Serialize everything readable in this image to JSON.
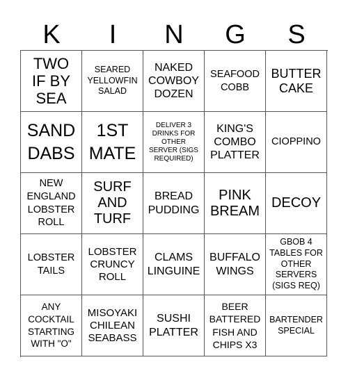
{
  "title_letters": [
    "K",
    "I",
    "N",
    "G",
    "S"
  ],
  "cells": [
    [
      "TWO IF BY SEA",
      "SEARED YELLOWFIN SALAD",
      "NAKED COWBOY DOZEN",
      "SEAFOOD COBB",
      "BUTTER CAKE"
    ],
    [
      "SAND DABS",
      "1ST MATE",
      "DELIVER 3 DRINKS FOR OTHER SERVER (SIGS REQUIRED)",
      "KING'S COMBO PLATTER",
      "CIOPPINO"
    ],
    [
      "NEW ENGLAND LOBSTER ROLL",
      "SURF AND TURF",
      "BREAD PUDDING",
      "PINK BREAM",
      "DECOY"
    ],
    [
      "LOBSTER TAILS",
      "LOBSTER CRUNCY ROLL",
      "CLAMS LINGUINE",
      "BUFFALO WINGS",
      "GBOB 4 TABLES FOR OTHER SERVERS (SIGS REQ)"
    ],
    [
      "ANY COCKTAIL STARTING WITH \"O\"",
      "MISOYAKI CHILEAN SEABASS",
      "SUSHI PLATTER",
      "BEER BATTERED FISH AND CHIPS X3",
      "BARTENDER SPECIAL"
    ]
  ]
}
